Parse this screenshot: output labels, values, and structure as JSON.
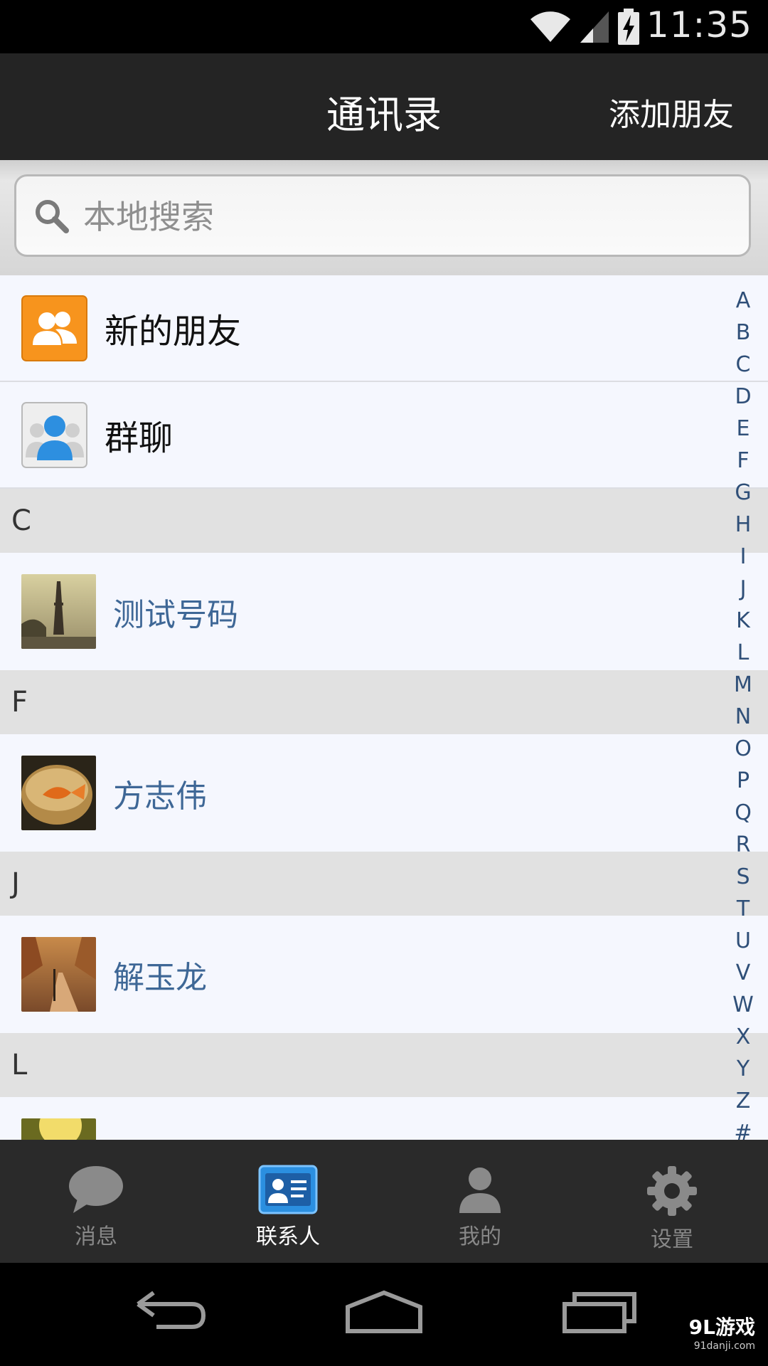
{
  "status_bar": {
    "time": "11:35",
    "icons": [
      "wifi-icon",
      "signal-icon",
      "battery-charging-icon"
    ]
  },
  "header": {
    "title": "通讯录",
    "add_friend": "添加朋友"
  },
  "search": {
    "placeholder": "本地搜索",
    "value": ""
  },
  "special_items": [
    {
      "label": "新的朋友",
      "icon": "new-friends-icon"
    },
    {
      "label": "群聊",
      "icon": "group-chat-icon"
    }
  ],
  "sections": [
    {
      "letter": "C",
      "contacts": [
        {
          "name": "测试号码",
          "avatar": "tower-photo"
        }
      ]
    },
    {
      "letter": "F",
      "contacts": [
        {
          "name": "方志伟",
          "avatar": "goldfish-photo"
        }
      ]
    },
    {
      "letter": "J",
      "contacts": [
        {
          "name": "解玉龙",
          "avatar": "autumn-path-photo"
        }
      ]
    },
    {
      "letter": "L",
      "contacts": [
        {
          "name": "",
          "avatar": "sunlight-photo"
        }
      ]
    }
  ],
  "index_letters": [
    "A",
    "B",
    "C",
    "D",
    "E",
    "F",
    "G",
    "H",
    "I",
    "J",
    "K",
    "L",
    "M",
    "N",
    "O",
    "P",
    "Q",
    "R",
    "S",
    "T",
    "U",
    "V",
    "W",
    "X",
    "Y",
    "Z",
    "#"
  ],
  "tabs": [
    {
      "label": "消息",
      "icon": "chat-bubble-icon",
      "active": false
    },
    {
      "label": "联系人",
      "icon": "contacts-card-icon",
      "active": true
    },
    {
      "label": "我的",
      "icon": "person-icon",
      "active": false
    },
    {
      "label": "设置",
      "icon": "gear-icon",
      "active": false
    }
  ],
  "nav_bar": {
    "buttons": [
      "back-icon",
      "home-icon",
      "recent-apps-icon"
    ]
  },
  "watermark": {
    "brand": "9L游戏",
    "url": "91danji.com"
  },
  "colors": {
    "title_bar": "#242424",
    "list_bg": "#f5f7fe",
    "section_bg": "#e1e1e1",
    "contact_name": "#3e6796",
    "new_friends_orange": "#f7941d",
    "tab_active_blue": "#2b8fe0"
  }
}
